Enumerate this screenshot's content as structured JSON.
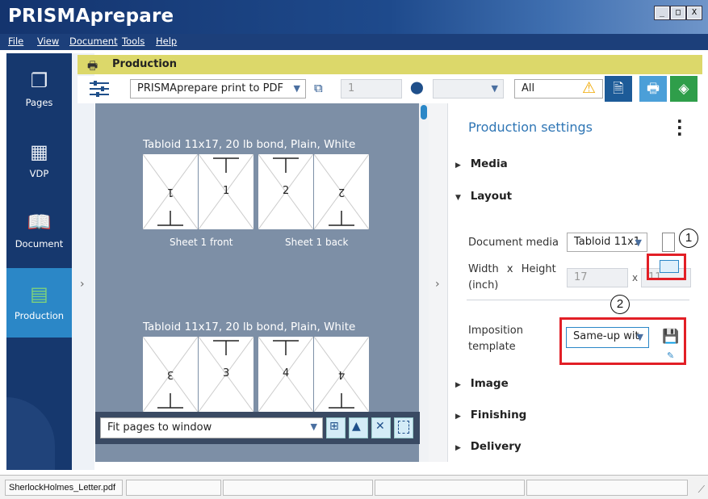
{
  "app": {
    "title": "PRISMAprepare"
  },
  "window_buttons": [
    "_",
    "□",
    "X"
  ],
  "menu": [
    "File",
    "View",
    "Document",
    "Tools",
    "Help"
  ],
  "sidebar": {
    "items": [
      {
        "label": "Pages",
        "icon": "pages-icon"
      },
      {
        "label": "VDP",
        "icon": "vdp-icon"
      },
      {
        "label": "Document",
        "icon": "book-icon"
      },
      {
        "label": "Production",
        "icon": "printer-stack-icon",
        "active": true
      }
    ]
  },
  "production_header": {
    "title": "Production"
  },
  "toolbar": {
    "printer": "PRISMAprepare print to PDF",
    "copies": "1",
    "location_value": "",
    "filter": "All"
  },
  "preview": {
    "sheets": [
      {
        "title": "Tabloid 11x17, 20 lb bond, Plain, White",
        "pages": [
          "1",
          "1",
          "2",
          "2"
        ],
        "flipped": [
          true,
          false,
          false,
          true
        ],
        "labels": [
          "Sheet 1 front",
          "Sheet 1 back"
        ]
      },
      {
        "title": "Tabloid 11x17, 20 lb bond, Plain, White",
        "pages": [
          "3",
          "3",
          "4",
          "4"
        ],
        "flipped": [
          true,
          false,
          false,
          true
        ],
        "labels": [
          "",
          ""
        ]
      }
    ],
    "fit_option": "Fit pages to window"
  },
  "settings": {
    "title": "Production settings",
    "sections": {
      "media": "Media",
      "layout": "Layout",
      "image": "Image",
      "finishing": "Finishing",
      "delivery": "Delivery"
    },
    "layout": {
      "document_media_label": "Document media",
      "document_media_value": "Tabloid 11x1",
      "width_label": "Width",
      "x_sep": "x",
      "height_label": "Height",
      "unit_label": "(inch)",
      "width_value": "17",
      "height_value": "11",
      "imposition_label_1": "Imposition",
      "imposition_label_2": "template",
      "imposition_value": "Same-up wit"
    },
    "callouts": [
      "1",
      "2"
    ]
  },
  "status": {
    "filename": "SherlockHolmes_Letter.pdf"
  },
  "colors": {
    "accent": "#2b87c7",
    "title_bar": "#1c3f7a",
    "header": "#dcd86a",
    "highlight": "#e21f26"
  }
}
